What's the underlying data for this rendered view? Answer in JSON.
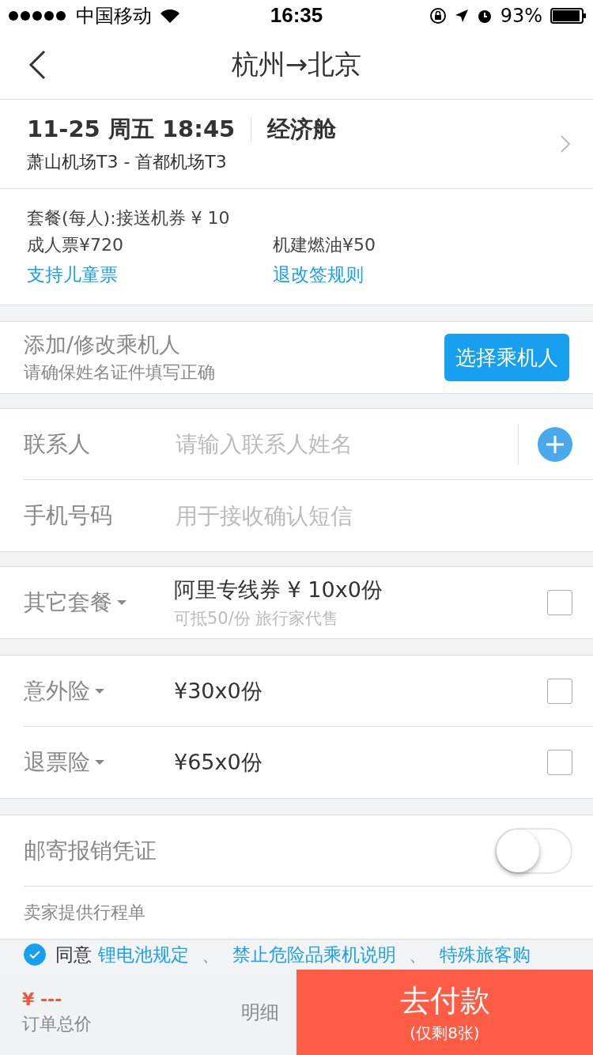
{
  "status_bar": {
    "carrier": "中国移动",
    "time": "16:35",
    "battery": "93%"
  },
  "nav": {
    "title": "杭州→北京"
  },
  "flight": {
    "datetime": "11-25 周五 18:45",
    "cabin": "经济舱",
    "airports": "萧山机场T3 - 首都机场T3"
  },
  "fare": {
    "package": "套餐(每人):接送机券 ¥ 10",
    "adult": "成人票¥720",
    "tax": "机建燃油¥50",
    "child_link": "支持儿童票",
    "rules_link": "退改签规则"
  },
  "passenger": {
    "title": "添加/修改乘机人",
    "hint": "请确保姓名证件填写正确",
    "button": "选择乘机人"
  },
  "contact": [
    {
      "label": "联系人",
      "placeholder": "请输入联系人姓名",
      "kind": "name"
    },
    {
      "label": "手机号码",
      "placeholder": "用于接收确认短信",
      "kind": "phone"
    }
  ],
  "extras": [
    {
      "label": "其它套餐",
      "title": "阿里专线券 ¥ 10x0份",
      "sub": "可抵50/份 旅行家代售",
      "checked": false
    }
  ],
  "insurance": [
    {
      "label": "意外险",
      "title": "¥30x0份",
      "checked": false
    },
    {
      "label": "退票险",
      "title": "¥65x0份",
      "checked": false
    }
  ],
  "mail": {
    "label": "邮寄报销凭证",
    "on": false,
    "note": "卖家提供行程单"
  },
  "agree": {
    "checked": true,
    "text": "同意",
    "links": [
      "锂电池规定",
      "禁止危险品乘机说明",
      "特殊旅客购"
    ],
    "separator": "、"
  },
  "footer": {
    "price": "¥ ---",
    "price_label": "订单总价",
    "detail": "明细",
    "pay": "去付款",
    "remaining": "(仅剩8张)"
  }
}
